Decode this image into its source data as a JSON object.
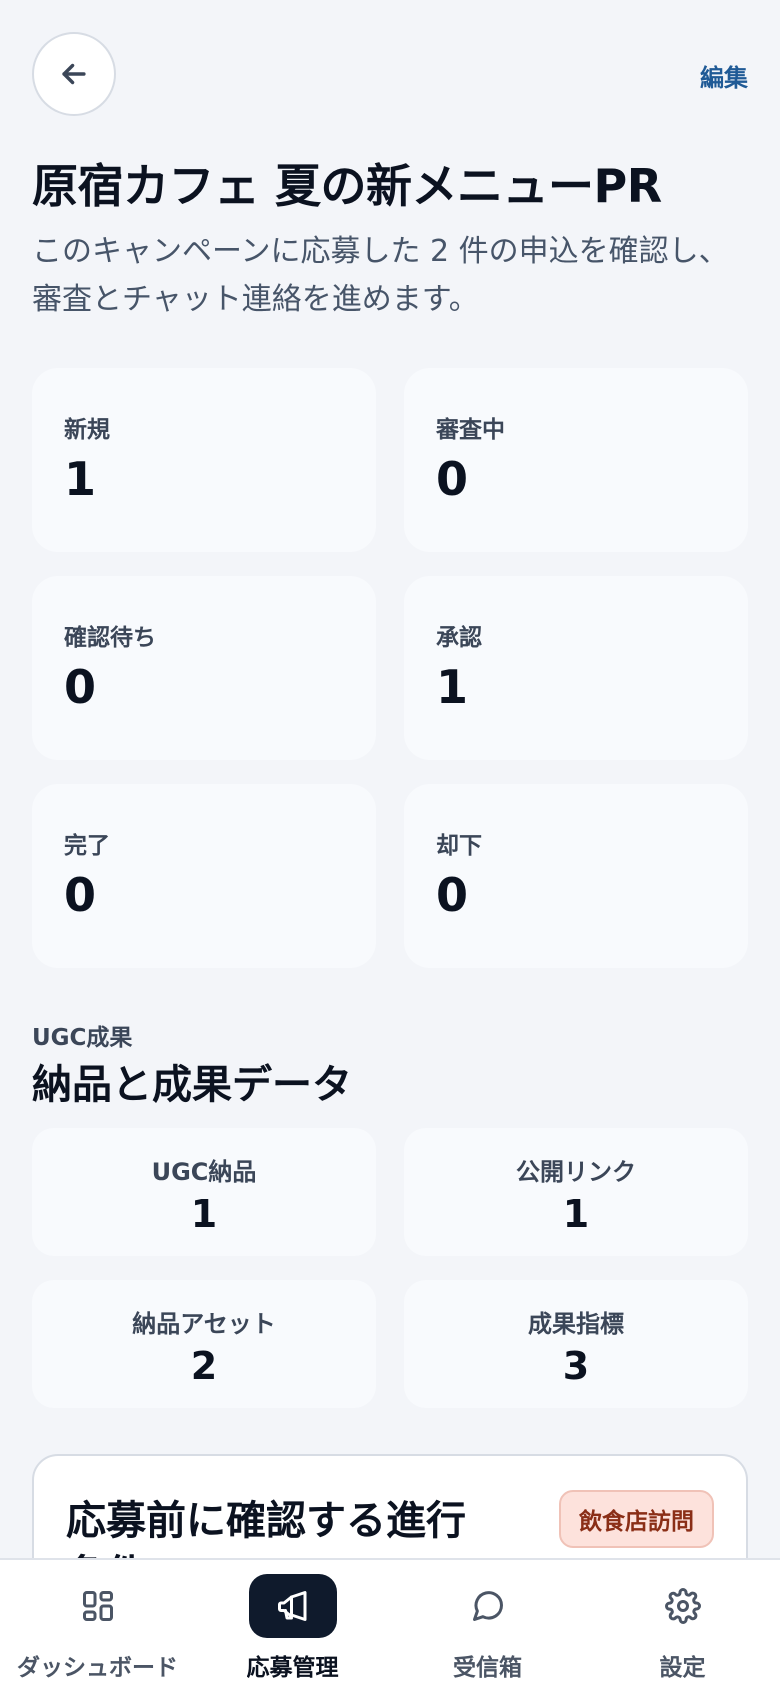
{
  "header": {
    "edit_label": "編集",
    "title": "原宿カフェ 夏の新メニューPR",
    "description": "このキャンペーンに応募した 2 件の申込を確認し、審査とチャット連絡を進めます。"
  },
  "status_counts": [
    {
      "label": "新規",
      "value": "1"
    },
    {
      "label": "審査中",
      "value": "0"
    },
    {
      "label": "確認待ち",
      "value": "0"
    },
    {
      "label": "承認",
      "value": "1"
    },
    {
      "label": "完了",
      "value": "0"
    },
    {
      "label": "却下",
      "value": "0"
    }
  ],
  "ugc_section": {
    "eyebrow": "UGC成果",
    "title": "納品と成果データ",
    "metrics": [
      {
        "label": "UGC納品",
        "value": "1"
      },
      {
        "label": "公開リンク",
        "value": "1"
      },
      {
        "label": "納品アセット",
        "value": "2"
      },
      {
        "label": "成果指標",
        "value": "3"
      }
    ]
  },
  "requirements_card": {
    "title": "応募前に確認する進行条件",
    "badge": "飲食店訪問"
  },
  "bottom_nav": {
    "items": [
      {
        "label": "ダッシュボード",
        "icon": "grid-icon",
        "active": false
      },
      {
        "label": "応募管理",
        "icon": "megaphone-icon",
        "active": true
      },
      {
        "label": "受信箱",
        "icon": "chat-bubble-icon",
        "active": false
      },
      {
        "label": "設定",
        "icon": "gear-icon",
        "active": false
      }
    ]
  },
  "colors": {
    "background": "#f3f5f9",
    "card": "#f8fafd",
    "accent_link": "#1f5a96",
    "nav_active": "#0f1a2c",
    "badge_bg": "#fde2dc",
    "badge_text": "#8a2e16"
  }
}
